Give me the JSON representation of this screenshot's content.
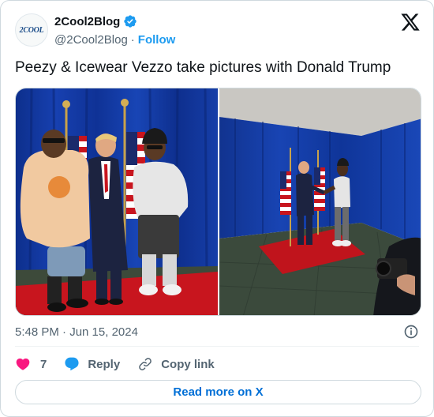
{
  "account": {
    "display_name": "2Cool2Blog",
    "handle": "@2Cool2Blog",
    "separator": "·",
    "follow_label": "Follow",
    "avatar_text": "2COOL",
    "verified": true
  },
  "tweet": {
    "text": "Peezy & Icewear Vezzo take pictures with Donald Trump",
    "timestamp": "5:48 PM · Jun 15, 2024"
  },
  "media": [
    {
      "id": "photo-1",
      "icon": "photo"
    },
    {
      "id": "photo-2",
      "icon": "photo"
    }
  ],
  "actions": {
    "like_count": "7",
    "reply_label": "Reply",
    "copy_link_label": "Copy link"
  },
  "footer": {
    "read_more_label": "Read more on X"
  },
  "colors": {
    "accent": "#1d9bf0",
    "link": "#006fd6",
    "like": "#f91880",
    "secondary_text": "#536471",
    "border": "#cfd9de"
  },
  "icons": [
    "verified-badge-icon",
    "x-logo-icon",
    "info-icon",
    "heart-icon",
    "reply-icon",
    "link-icon"
  ]
}
